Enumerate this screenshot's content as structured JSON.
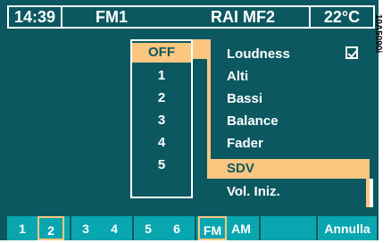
{
  "header": {
    "time": "14:39",
    "band": "FM1",
    "station": "RAI MF2",
    "temperature": "22°C"
  },
  "side_code": "10A5090i",
  "menu": {
    "items": [
      {
        "label": "Loudness",
        "checked": true
      },
      {
        "label": "Alti"
      },
      {
        "label": "Bassi"
      },
      {
        "label": "Balance"
      },
      {
        "label": "Fader"
      },
      {
        "label": "SDV",
        "selected": true
      },
      {
        "label": "Vol. Iniz."
      }
    ]
  },
  "popup": {
    "options": [
      "OFF",
      "1",
      "2",
      "3",
      "4",
      "5"
    ],
    "selected": "OFF"
  },
  "bottom_bar": {
    "presets": [
      "1",
      "2",
      "3",
      "4",
      "5",
      "6"
    ],
    "active_preset": "2",
    "bands": [
      "FM",
      "AM"
    ],
    "active_band": "FM",
    "cancel_label": "Annulla"
  },
  "colors": {
    "background": "#0c5860",
    "accent": "#fbc680",
    "bottom_bar": "#0aa6b0"
  }
}
